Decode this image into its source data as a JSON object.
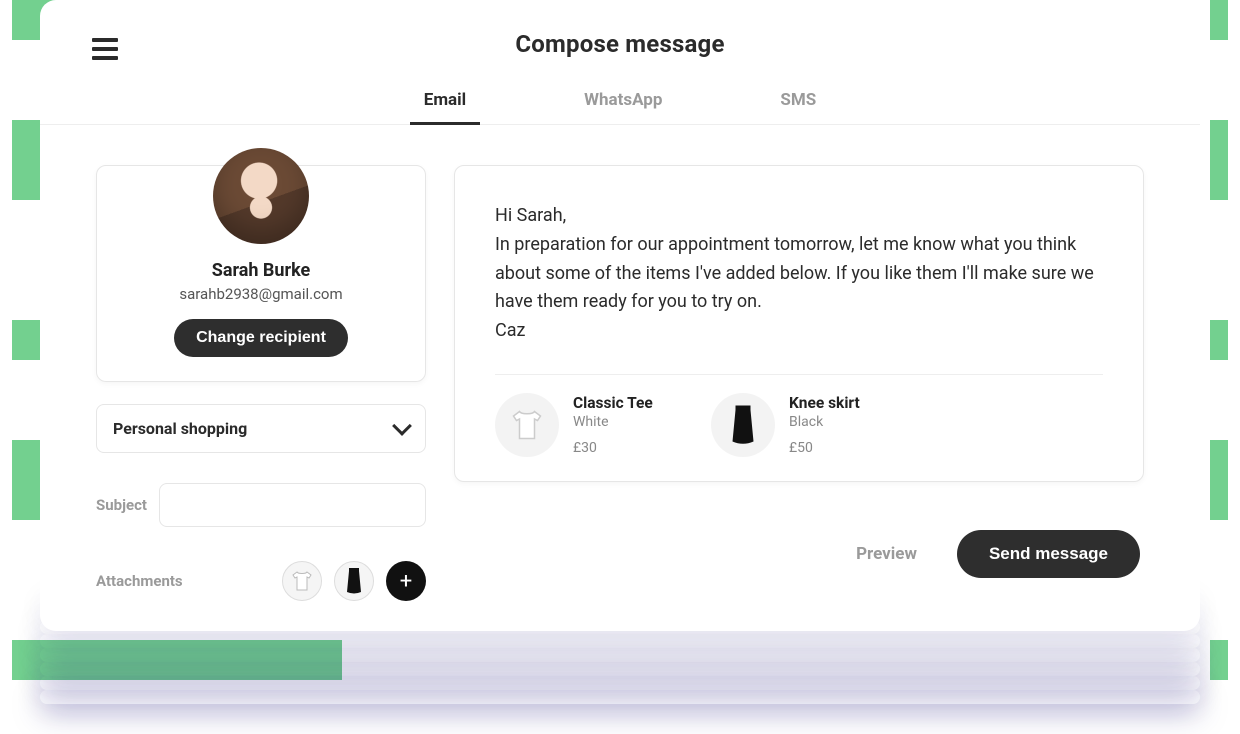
{
  "header": {
    "title": "Compose message",
    "tabs": [
      {
        "label": "Email",
        "active": true
      },
      {
        "label": "WhatsApp",
        "active": false
      },
      {
        "label": "SMS",
        "active": false
      }
    ]
  },
  "recipient": {
    "name": "Sarah Burke",
    "email": "sarahb2938@gmail.com",
    "change_label": "Change recipient"
  },
  "category_select": {
    "value": "Personal shopping"
  },
  "subject": {
    "label": "Subject",
    "value": ""
  },
  "attachments": {
    "label": "Attachments",
    "items": [
      {
        "name": "Classic Tee",
        "icon": "tee"
      },
      {
        "name": "Knee skirt",
        "icon": "skirt"
      }
    ],
    "add_label": "+"
  },
  "message": {
    "greeting": "Hi Sarah,",
    "body": "In preparation for our appointment tomorrow, let me know what you think about some of the items I've added below. If you like them I'll make sure we have them ready for you to try on.",
    "signoff": "Caz",
    "products": [
      {
        "name": "Classic Tee",
        "variant": "White",
        "price": "£30",
        "icon": "tee"
      },
      {
        "name": "Knee skirt",
        "variant": "Black",
        "price": "£50",
        "icon": "skirt"
      }
    ]
  },
  "actions": {
    "preview_label": "Preview",
    "send_label": "Send message"
  }
}
